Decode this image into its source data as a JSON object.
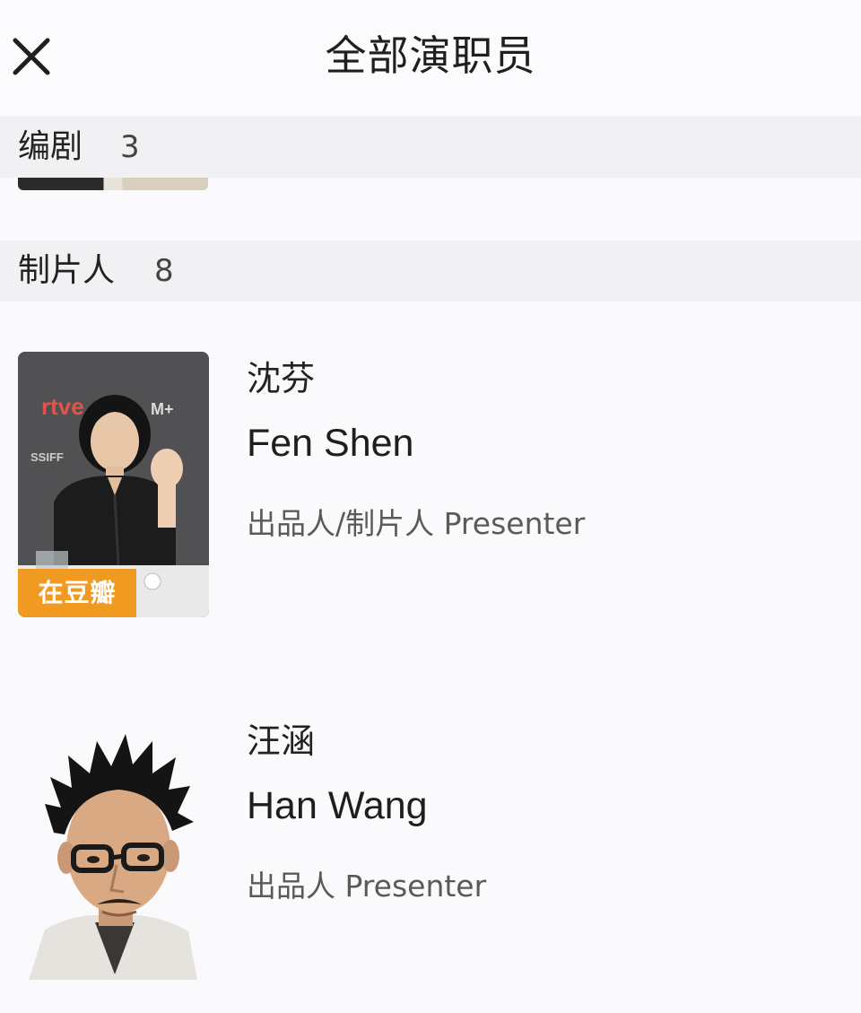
{
  "header": {
    "title": "全部演职员",
    "close_icon": "close-icon"
  },
  "sections": [
    {
      "title": "编剧",
      "count": "3"
    },
    {
      "title": "制片人",
      "count": "8"
    }
  ],
  "people": [
    {
      "name_cn": "沈芬",
      "name_en": "Fen Shen",
      "role": "出品人/制片人 Presenter",
      "badge": "在豆瓣"
    },
    {
      "name_cn": "汪涵",
      "name_en": "Han Wang",
      "role": "出品人 Presenter"
    }
  ],
  "colors": {
    "badge_bg": "#f09a22",
    "section_bg": "#f1f1f3",
    "page_bg": "#fafafc"
  }
}
